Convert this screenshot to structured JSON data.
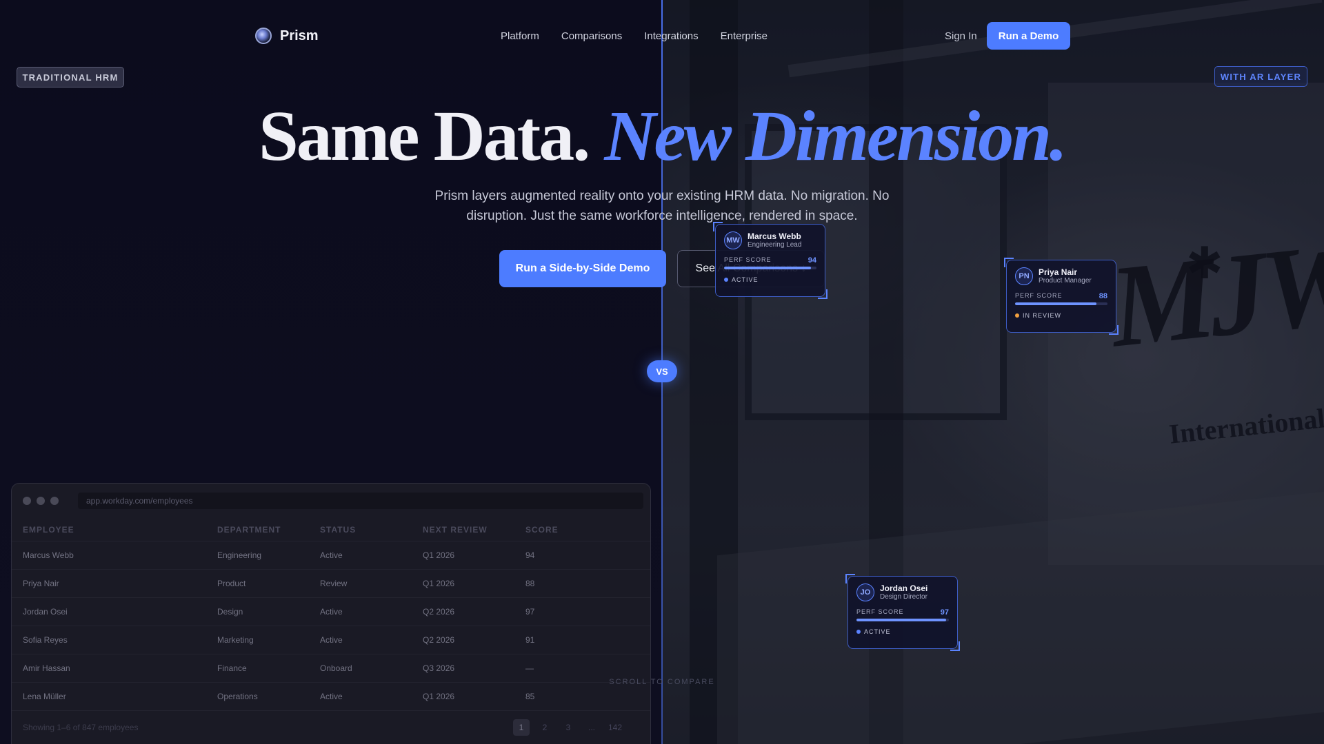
{
  "brand": {
    "name": "Prism"
  },
  "nav": {
    "links": [
      "Platform",
      "Comparisons",
      "Integrations",
      "Enterprise"
    ],
    "signin_label": "Sign In",
    "demo_label": "Run a Demo"
  },
  "badges": {
    "left": "TRADITIONAL HRM",
    "right": "WITH AR LAYER"
  },
  "hero": {
    "title_a": "Same Data.",
    "title_b": "New Dimension.",
    "subtitle": "Prism layers augmented reality onto your existing HRM data. No migration. No disruption. Just the same workforce intelligence, rendered in space.",
    "cta_primary": "Run a Side-by-Side Demo",
    "cta_secondary": "See All Comparisons ↓"
  },
  "vs_label": "VS",
  "scroll_hint": "SCROLL TO COMPARE",
  "ar_cards": [
    {
      "initials": "MW",
      "name": "Marcus Webb",
      "role": "Engineering Lead",
      "score_label": "PERF SCORE",
      "score": "94",
      "progress": 0.94,
      "status": "ACTIVE",
      "status_color": "#5b83ff"
    },
    {
      "initials": "PN",
      "name": "Priya Nair",
      "role": "Product Manager",
      "score_label": "PERF SCORE",
      "score": "88",
      "progress": 0.88,
      "status": "IN REVIEW",
      "status_color": "#f0a040"
    },
    {
      "initials": "JO",
      "name": "Jordan Osei",
      "role": "Design Director",
      "score_label": "PERF SCORE",
      "score": "97",
      "progress": 0.97,
      "status": "ACTIVE",
      "status_color": "#5b83ff"
    }
  ],
  "browser": {
    "url": "app.workday.com/employees",
    "columns": [
      "EMPLOYEE",
      "DEPARTMENT",
      "STATUS",
      "NEXT REVIEW",
      "SCORE"
    ],
    "rows": [
      [
        "Marcus Webb",
        "Engineering",
        "Active",
        "Q1 2026",
        "94"
      ],
      [
        "Priya Nair",
        "Product",
        "Review",
        "Q1 2026",
        "88"
      ],
      [
        "Jordan Osei",
        "Design",
        "Active",
        "Q2 2026",
        "97"
      ],
      [
        "Sofia Reyes",
        "Marketing",
        "Active",
        "Q2 2026",
        "91"
      ],
      [
        "Amir Hassan",
        "Finance",
        "Onboard",
        "Q3 2026",
        "—"
      ],
      [
        "Lena Müller",
        "Operations",
        "Active",
        "Q1 2026",
        "85"
      ]
    ],
    "footer_text": "Showing 1–6 of 847 employees",
    "pages": [
      "1",
      "2",
      "3",
      "...",
      "142"
    ]
  },
  "colors": {
    "accent": "#4d7cff",
    "background": "#0b0b1a"
  }
}
